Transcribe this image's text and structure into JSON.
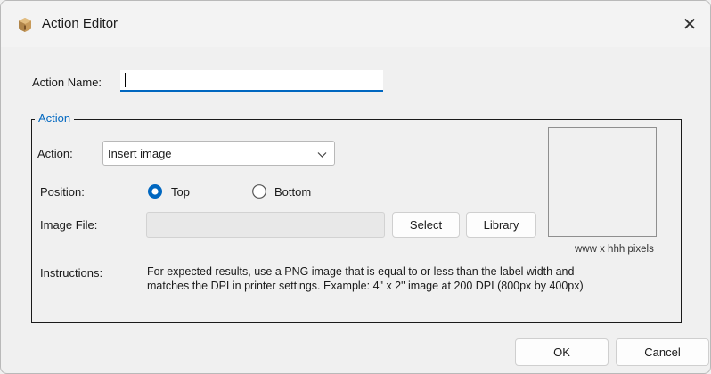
{
  "window": {
    "title": "Action Editor",
    "close_glyph": "✕",
    "app_icon": "package-box-icon"
  },
  "action_name": {
    "label": "Action Name:",
    "value": ""
  },
  "action_group": {
    "legend": "Action",
    "action_label": "Action:",
    "action_value": "Insert image",
    "position_label": "Position:",
    "position_options": [
      {
        "label": "Top",
        "selected": true
      },
      {
        "label": "Bottom",
        "selected": false
      }
    ],
    "image_file_label": "Image File:",
    "image_file_value": "",
    "select_button": "Select",
    "library_button": "Library",
    "preview_caption": "www x hhh pixels",
    "instructions_label": "Instructions:",
    "instructions_line1": "For expected results, use a PNG image that is equal to or less than the label width and",
    "instructions_line2": "matches the DPI in printer settings. Example: 4\" x 2\" image at 200 DPI (800px by 400px)"
  },
  "footer": {
    "ok_button": "OK",
    "cancel_button": "Cancel"
  },
  "colors": {
    "accent": "#0067c0",
    "group_legend": "#0067c0"
  }
}
